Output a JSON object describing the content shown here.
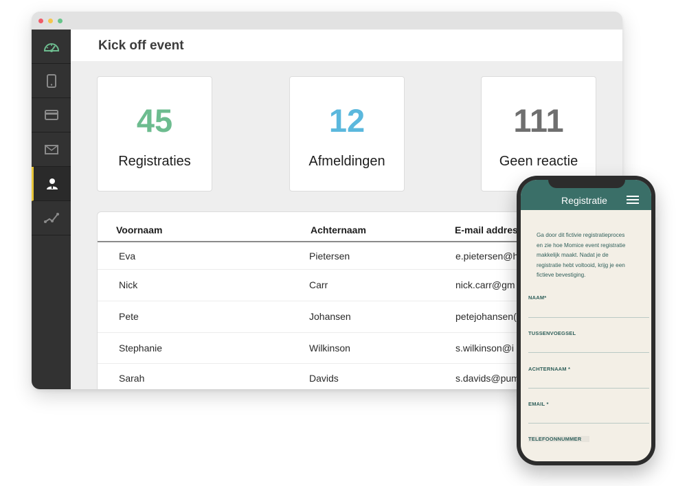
{
  "window": {
    "page_title": "Kick off event"
  },
  "sidebar": {
    "items": [
      {
        "icon": "dashboard-gauge-icon"
      },
      {
        "icon": "tablet-icon"
      },
      {
        "icon": "credit-card-icon"
      },
      {
        "icon": "envelope-icon"
      },
      {
        "icon": "user-icon",
        "active": true
      },
      {
        "icon": "analytics-chart-icon"
      }
    ]
  },
  "stats": [
    {
      "value": "45",
      "label": "Registraties",
      "color": "#6dbc8f"
    },
    {
      "value": "12",
      "label": "Afmeldingen",
      "color": "#5bb8dd"
    },
    {
      "value": "111",
      "label": "Geen reactie",
      "color": "#6f6f6f"
    }
  ],
  "table": {
    "headers": [
      "Voornaam",
      "Achternaam",
      "E-mail address"
    ],
    "rows": [
      [
        "Eva",
        "Pietersen",
        "e.pietersen@h"
      ],
      [
        "Nick",
        "Carr",
        "nick.carr@gm"
      ],
      [
        "Pete",
        "Johansen",
        "petejohansen("
      ],
      [
        "Stephanie",
        "Wilkinson",
        "s.wilkinson@i"
      ],
      [
        "Sarah",
        "Davids",
        "s.davids@pum"
      ]
    ]
  },
  "phone": {
    "title": "Registratie",
    "intro_lines": [
      "Ga door dit fictivie registratieproces",
      "en zie hoe Momice event registratie",
      "makkelijk maakt. Nadat je de",
      "registratie hebt voltooid, krijg je een",
      "fictieve bevestiging."
    ],
    "fields": [
      "NAAM*",
      "TUSSENVOEGSEL",
      "ACHTERNAAM *",
      "EMAIL *",
      "TELEFOONNUMMER"
    ]
  }
}
